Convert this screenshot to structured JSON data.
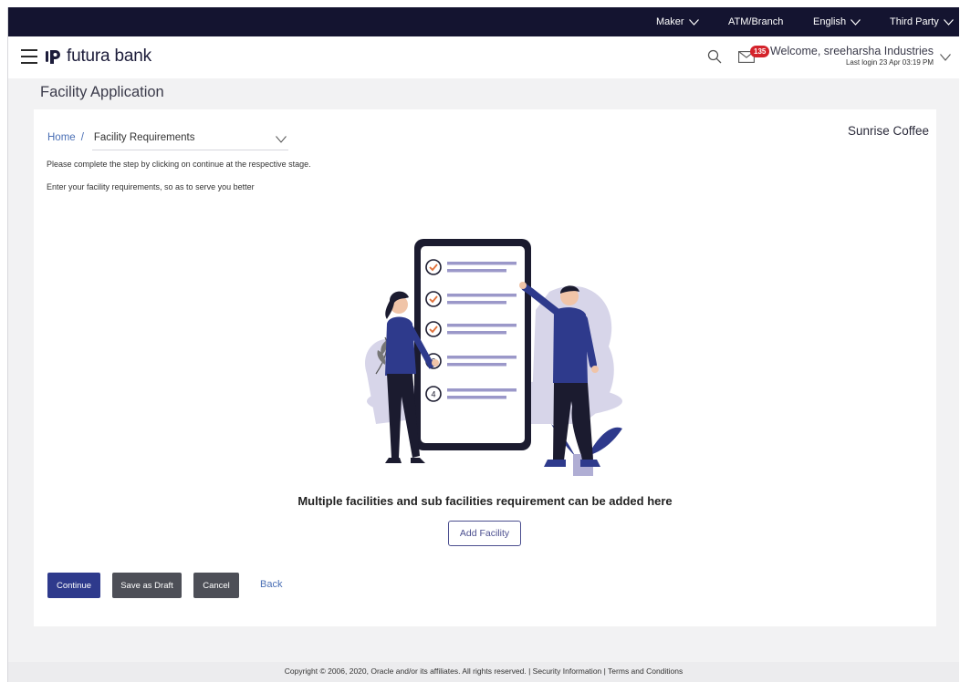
{
  "topbar": {
    "role": "Maker",
    "atm_branch": "ATM/Branch",
    "language": "English",
    "third_party": "Third Party"
  },
  "header": {
    "brand": "futura bank",
    "notification_count": "135",
    "welcome": "Welcome, sreeharsha Industries",
    "last_login": "Last login 23 Apr 03:19 PM"
  },
  "page": {
    "title": "Facility Application",
    "company": "Sunrise Coffee"
  },
  "breadcrumb": {
    "home": "Home",
    "separator": "/",
    "current": "Facility Requirements"
  },
  "content": {
    "instruction": "Please complete the step by clicking on continue at the respective stage.",
    "subtext": "Enter your facility requirements, so as to serve you better",
    "message": "Multiple facilities and sub facilities requirement can be added here",
    "add_label": "Add Facility",
    "checklist_numbers": [
      "3",
      "4"
    ]
  },
  "actions": {
    "continue": "Continue",
    "save_draft": "Save as Draft",
    "cancel": "Cancel",
    "back": "Back"
  },
  "footer": {
    "text": "Copyright © 2006, 2020, Oracle and/or its affiliates. All rights reserved. | Security Information | Terms and Conditions"
  },
  "colors": {
    "topbar": "#141430",
    "primary": "#2e3a8c",
    "secondary": "#4d4f57",
    "link": "#4a6fb5",
    "badge": "#d4232b",
    "illustration_lilac": "#d7d5e9",
    "check_orange": "#e0703a"
  }
}
